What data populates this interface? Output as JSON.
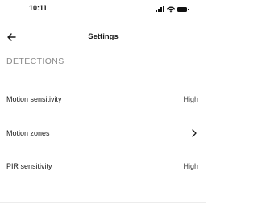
{
  "status_bar": {
    "time": "10:11",
    "icons": [
      "cellular-signal-icon",
      "wifi-icon",
      "battery-icon"
    ]
  },
  "nav": {
    "back_icon": "arrow-left-icon",
    "title": "Settings"
  },
  "section": {
    "title": "DETECTIONS"
  },
  "rows": [
    {
      "label": "Motion sensitivity",
      "value": "High"
    },
    {
      "label": "Motion zones",
      "icon": "chevron-right-icon"
    },
    {
      "label": "PIR sensitivity",
      "value": "High"
    }
  ]
}
